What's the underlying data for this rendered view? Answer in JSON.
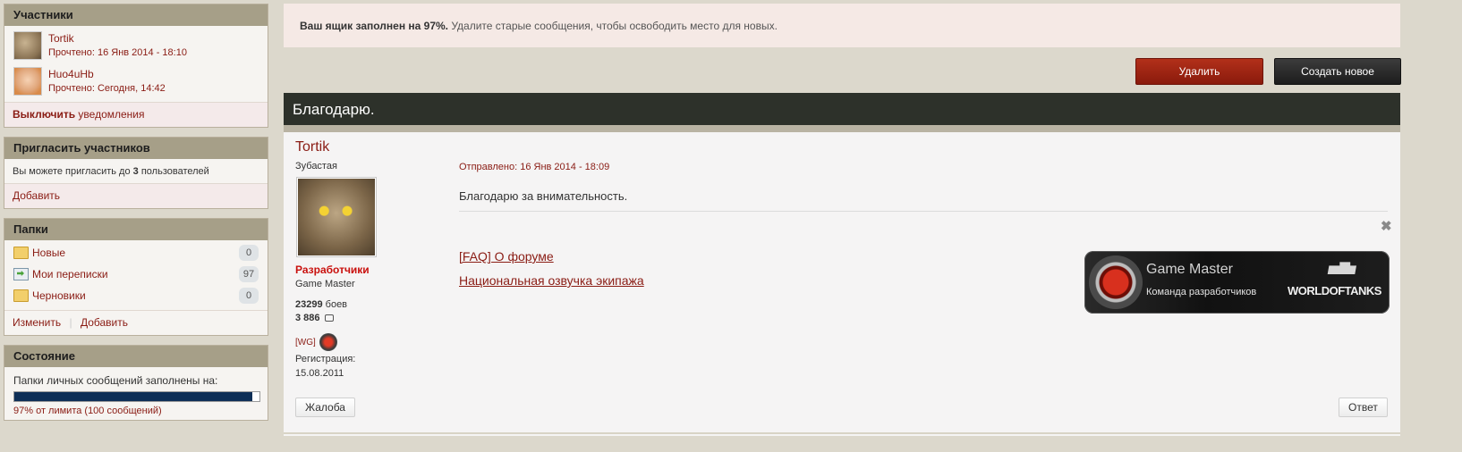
{
  "sidebar": {
    "members": {
      "title": "Участники",
      "items": [
        {
          "name": "Tortik",
          "read": "Прочтено: 16 Янв 2014 - 18:10"
        },
        {
          "name": "Huo4uHb",
          "read": "Прочтено: Сегодня, 14:42"
        }
      ],
      "notify_bold": "Выключить",
      "notify_text": "уведомления"
    },
    "invite": {
      "title": "Пригласить участников",
      "text_before": "Вы можете пригласить до ",
      "limit": "3",
      "text_after": " пользователей",
      "add": "Добавить"
    },
    "folders": {
      "title": "Папки",
      "items": [
        {
          "label": "Новые",
          "count": "0",
          "icon": "folder-icon"
        },
        {
          "label": "Мои переписки",
          "count": "97",
          "icon": "mail-icon"
        },
        {
          "label": "Черновики",
          "count": "0",
          "icon": "folder-icon"
        }
      ],
      "edit": "Изменить",
      "add": "Добавить"
    },
    "status": {
      "title": "Состояние",
      "text": "Папки личных сообщений заполнены на:",
      "percent": 97,
      "caption": "97% от лимита (100 сообщений)"
    }
  },
  "notice": {
    "bold": "Ваш ящик заполнен на 97%.",
    "text": " Удалите старые сообщения, чтобы освободить место для новых."
  },
  "actions": {
    "delete": "Удалить",
    "create": "Создать новое"
  },
  "topic": {
    "title": "Благодарю."
  },
  "post": {
    "author": "Tortik",
    "author_title": "Зубастая",
    "group": "Разработчики",
    "rank": "Game Master",
    "battles_num": "23299",
    "battles_label": " боев",
    "posts_num": "3 886",
    "clan": "[WG]",
    "reg_label": "Регистрация:",
    "reg_date": "15.08.2011",
    "sent": "Отправлено: 16 Янв 2014 - 18:09",
    "body": "Благодарю за внимательность.",
    "links": [
      "[FAQ] О форуме",
      "Национальная озвучка экипажа"
    ],
    "banner": {
      "title": "Game Master",
      "subtitle": "Команда разработчиков",
      "brand": "WORLDOFTANKS"
    },
    "complain": "Жалоба",
    "reply": "Ответ",
    "close_symbol": "✖"
  }
}
